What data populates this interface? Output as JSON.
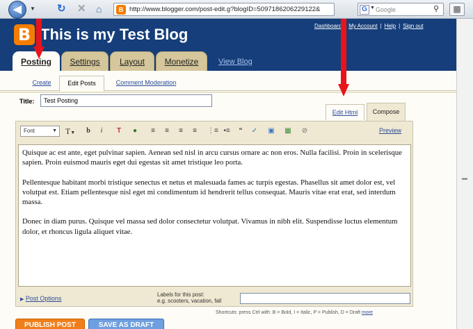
{
  "browser": {
    "url": "http://www.blogger.com/post-edit.g?blogID=5097186206229122&",
    "search_placeholder": "Google",
    "site_icon_glyph": "B",
    "search_engine_glyph": "G"
  },
  "blog": {
    "logo_glyph": "B",
    "title": "This is my Test Blog",
    "top_links": [
      "Dashboard",
      "My Account",
      "Help",
      "Sign out"
    ],
    "top_links_sep": "|"
  },
  "main_tabs": [
    "Posting",
    "Settings",
    "Layout",
    "Monetize"
  ],
  "view_blog_label": "View Blog",
  "sub_tabs": [
    "Create",
    "Edit Posts",
    "Comment Moderation"
  ],
  "post": {
    "title_label": "Title:",
    "title_value": "Test Posting"
  },
  "editor": {
    "tabs": [
      "Edit Html",
      "Compose"
    ],
    "font_label": "Font",
    "size_glyph": "T",
    "preview_label": "Preview",
    "paragraphs": [
      "Quisque ac est ante, eget pulvinar sapien. Aenean sed nisl in arcu cursus ornare ac non eros. Nulla facilisi. Proin in scelerisque sapien. Proin euismod mauris eget dui egestas sit amet tristique leo porta.",
      "Pellentesque habitant morbi tristique senectus et netus et malesuada fames ac turpis egestas. Phasellus sit amet dolor est, vel volutpat est. Etiam pellentesque nisl eget mi condimentum id hendrerit tellus consequat. Mauris vitae erat erat, sed interdum massa.",
      "Donec in diam purus. Quisque vel massa sed dolor consectetur volutpat. Vivamus in nibh elit. Suspendisse luctus elementum dolor, et rhoncus ligula aliquet vitae."
    ],
    "post_options_label": "Post Options",
    "labels_title": "Labels for this post:",
    "labels_hint": "e.g. scooters, vacation, fall",
    "labels_value": ""
  },
  "shortcuts": {
    "text": "Shortcuts: press Ctrl with: B = Bold, I = Italic, P = Publish, D = Draft",
    "more_label": "more"
  },
  "actions": {
    "publish_label": "PUBLISH POST",
    "draft_label": "SAVE AS DRAFT"
  },
  "colors": {
    "header_bg": "#153e7a",
    "tab_bg": "#d5c79b",
    "annotation_arrow": "#e8141b",
    "publish_bg": "#ef7f1a",
    "draft_bg": "#6e9fe0"
  }
}
